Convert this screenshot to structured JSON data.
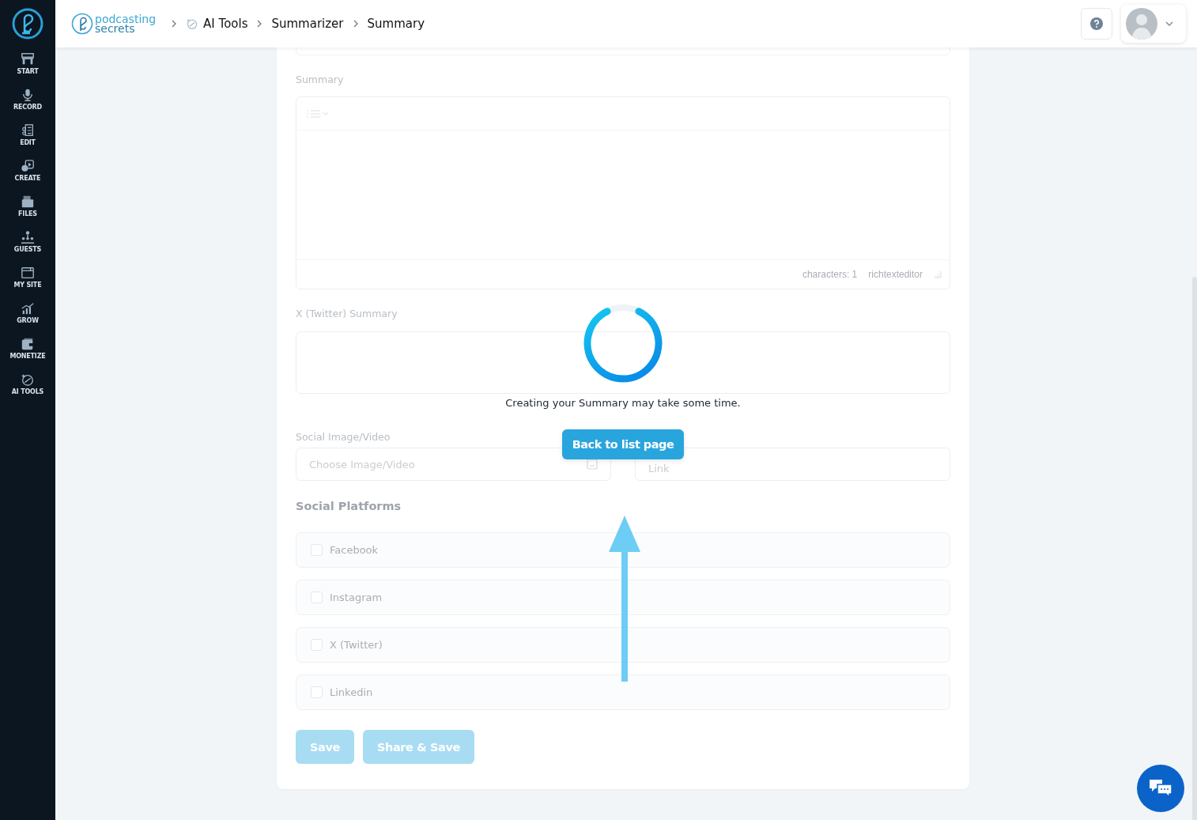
{
  "sidebar": {
    "items": [
      {
        "label": "START"
      },
      {
        "label": "RECORD"
      },
      {
        "label": "EDIT"
      },
      {
        "label": "CREATE"
      },
      {
        "label": "FILES"
      },
      {
        "label": "GUESTS"
      },
      {
        "label": "MY SITE"
      },
      {
        "label": "GROW"
      },
      {
        "label": "MONETIZE"
      },
      {
        "label": "AI TOOLS"
      }
    ]
  },
  "header": {
    "logo": {
      "line1": "podcasting",
      "line2": "secrets"
    },
    "breadcrumb": [
      {
        "label": "AI Tools",
        "kind": "tool"
      },
      {
        "label": "Summarizer",
        "kind": "plain"
      },
      {
        "label": "Summary",
        "kind": "plain"
      }
    ]
  },
  "form": {
    "summary": {
      "label": "Summary",
      "characters": "characters: 1",
      "editor_name": "richtexteditor"
    },
    "twitter_summary": {
      "label": "X (Twitter) Summary"
    },
    "social_media": {
      "label": "Social Image/Video",
      "placeholder": "Choose Image/Video"
    },
    "social_link": {
      "placeholder": "Link"
    },
    "platforms": {
      "title": "Social Platforms",
      "items": [
        {
          "label": "Facebook",
          "checked": false
        },
        {
          "label": "Instagram",
          "checked": false
        },
        {
          "label": "X (Twitter)",
          "checked": false
        },
        {
          "label": "Linkedin",
          "checked": false
        }
      ]
    },
    "buttons": [
      {
        "label": "Save",
        "disabled": true
      },
      {
        "label": "Share & Save",
        "disabled": true
      }
    ]
  },
  "loader": {
    "message": "Creating your Summary may take some time.",
    "button": "Back to list page"
  }
}
